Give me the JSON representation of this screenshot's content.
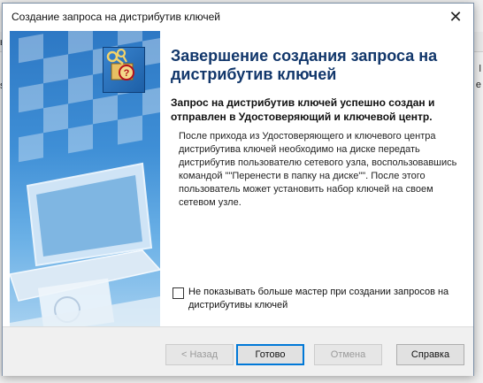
{
  "window": {
    "title": "Создание запроса на дистрибутив ключей"
  },
  "background_fragments": {
    "a": "ы",
    "b": "se",
    "c": "l",
    "d": "e"
  },
  "page": {
    "heading": "Завершение создания запроса на дистрибутив ключей",
    "subtitle": "Запрос на дистрибутив ключей успешно создан и отправлен в Удостоверяющий и ключевой центр.",
    "body": "После прихода из Удостоверяющего и ключевого центра дистрибутива ключей необходимо на диске передать дистрибутив пользователю сетевого узла, воспользовавшись командой \"\"Перенести в папку на диске\"\". После этого пользователь может установить набор ключей на своем сетевом узле.",
    "checkbox_label": "Не показывать больше мастер при создании запросов на дистрибутивы ключей",
    "checkbox_checked": false
  },
  "buttons": {
    "back": "< Назад",
    "finish": "Готово",
    "cancel": "Отмена",
    "help": "Справка"
  },
  "colors": {
    "heading": "#12376b",
    "accent": "#0078d7",
    "banner": "#2d78c4"
  },
  "icons": {
    "close": "close-icon",
    "wizard": "keys-wizard-icon"
  }
}
